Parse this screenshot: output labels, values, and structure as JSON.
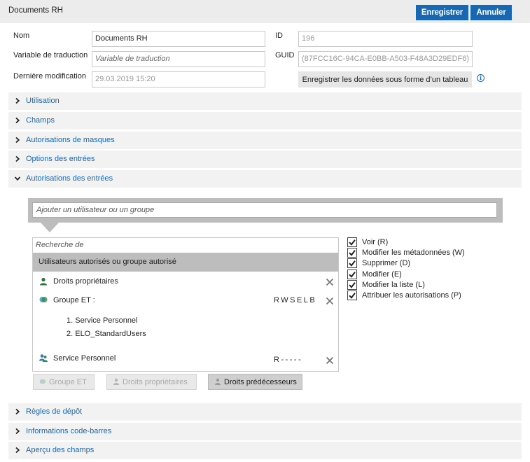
{
  "header": {
    "title": "Documents RH",
    "save_label": "Enregistrer",
    "cancel_label": "Annuler"
  },
  "form": {
    "name_label": "Nom",
    "name_value": "Documents RH",
    "translation_label": "Variable de traduction",
    "translation_placeholder": "Variable de traduction",
    "modified_label": "Dernière modification",
    "modified_value": "29.03.2019 15:20",
    "id_label": "ID",
    "id_value": "196",
    "guid_label": "GUID",
    "guid_value": "(87FCC16C-94CA-E0BB-A503-F48A3D29EDF6)",
    "table_button_label": "Enregistrer les données sous forme d’un tableau",
    "info_glyph": "i"
  },
  "sections_top": [
    {
      "label": "Utilisation",
      "expanded": false
    },
    {
      "label": "Champs",
      "expanded": false
    },
    {
      "label": "Autorisations de masques",
      "expanded": false
    },
    {
      "label": "Options des entrées",
      "expanded": false
    },
    {
      "label": "Autorisations des entrées",
      "expanded": true
    }
  ],
  "permissions": {
    "add_placeholder": "Ajouter un utilisateur ou un groupe",
    "search_placeholder": "Recherche de",
    "list_header": "Utilisateurs autorisés ou groupe autorisé",
    "entries": [
      {
        "icon": "user-icon",
        "name": "Droits propriétaires",
        "rights": ""
      },
      {
        "icon": "group-icon",
        "name": "Groupe ET :",
        "rights": "RWSELB",
        "members": [
          "1. Service Personnel",
          "2. ELO_StandardUsers"
        ]
      },
      {
        "icon": "users-icon",
        "name": "Service Personnel",
        "rights": "R-----"
      }
    ],
    "footer_buttons": [
      {
        "label": "Groupe ET",
        "icon": "group-icon",
        "enabled": false
      },
      {
        "label": "Droits propriétaires",
        "icon": "user-icon",
        "enabled": false
      },
      {
        "label": "Droits prédécesseurs",
        "icon": "user-icon",
        "enabled": true
      }
    ],
    "checkboxes": [
      {
        "label": "Voir (R)",
        "checked": true
      },
      {
        "label": "Modifier les métadonnées (W)",
        "checked": true
      },
      {
        "label": "Supprimer (D)",
        "checked": true
      },
      {
        "label": "Modifier (E)",
        "checked": true
      },
      {
        "label": "Modifier la liste (L)",
        "checked": true
      },
      {
        "label": "Attribuer les autorisations (P)",
        "checked": true
      }
    ]
  },
  "sections_bottom": [
    {
      "label": "Règles de dépôt",
      "expanded": false
    },
    {
      "label": "Informations code-barres",
      "expanded": false
    },
    {
      "label": "Aperçu des champs",
      "expanded": false
    }
  ],
  "colors": {
    "accent": "#1a67b1",
    "header_bg": "#ececec",
    "section_bg": "#f2f2f2",
    "frame_grey": "#bdbdbd"
  }
}
